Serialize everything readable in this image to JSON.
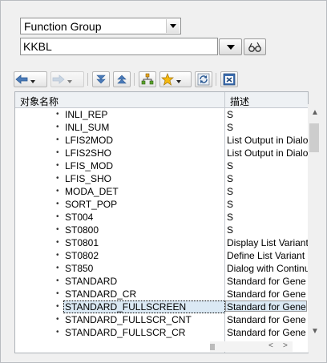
{
  "object_selector": {
    "type_value": "Function Group",
    "name_value": "KKBL"
  },
  "toolbar": {
    "icons": [
      "back-arrow-icon",
      "forward-arrow-icon",
      "collapse-icon",
      "expand-icon",
      "hierarchy-icon",
      "favorites-star-icon",
      "refresh-icon",
      "close-window-icon"
    ]
  },
  "table": {
    "col_object_name": "对象名称",
    "col_description": "描述",
    "rows": [
      {
        "name": "INLI_REP",
        "desc": "S"
      },
      {
        "name": "INLI_SUM",
        "desc": "S"
      },
      {
        "name": "LFIS2MOD",
        "desc": "List Output in Dialo"
      },
      {
        "name": "LFIS2SHO",
        "desc": "List Output in Dialo"
      },
      {
        "name": "LFIS_MOD",
        "desc": "S"
      },
      {
        "name": "LFIS_SHO",
        "desc": "S"
      },
      {
        "name": "MODA_DET",
        "desc": "S"
      },
      {
        "name": "SORT_POP",
        "desc": "S"
      },
      {
        "name": "ST004",
        "desc": "S"
      },
      {
        "name": "ST0800",
        "desc": "S"
      },
      {
        "name": "ST0801",
        "desc": "Display List Variant"
      },
      {
        "name": "ST0802",
        "desc": "Define List Variant"
      },
      {
        "name": "ST850",
        "desc": "Dialog with Continu"
      },
      {
        "name": "STANDARD",
        "desc": "Standard for Gene"
      },
      {
        "name": "STANDARD_CR",
        "desc": "Standard for Gene"
      },
      {
        "name": "STANDARD_FULLSCREEN",
        "desc": "Standard for Gene",
        "selected": true
      },
      {
        "name": "STANDARD_FULLSCR_CNT",
        "desc": "Standard for Gene"
      },
      {
        "name": "STANDARD_FULLSCR_CR",
        "desc": "Standard for Gene"
      }
    ]
  }
}
